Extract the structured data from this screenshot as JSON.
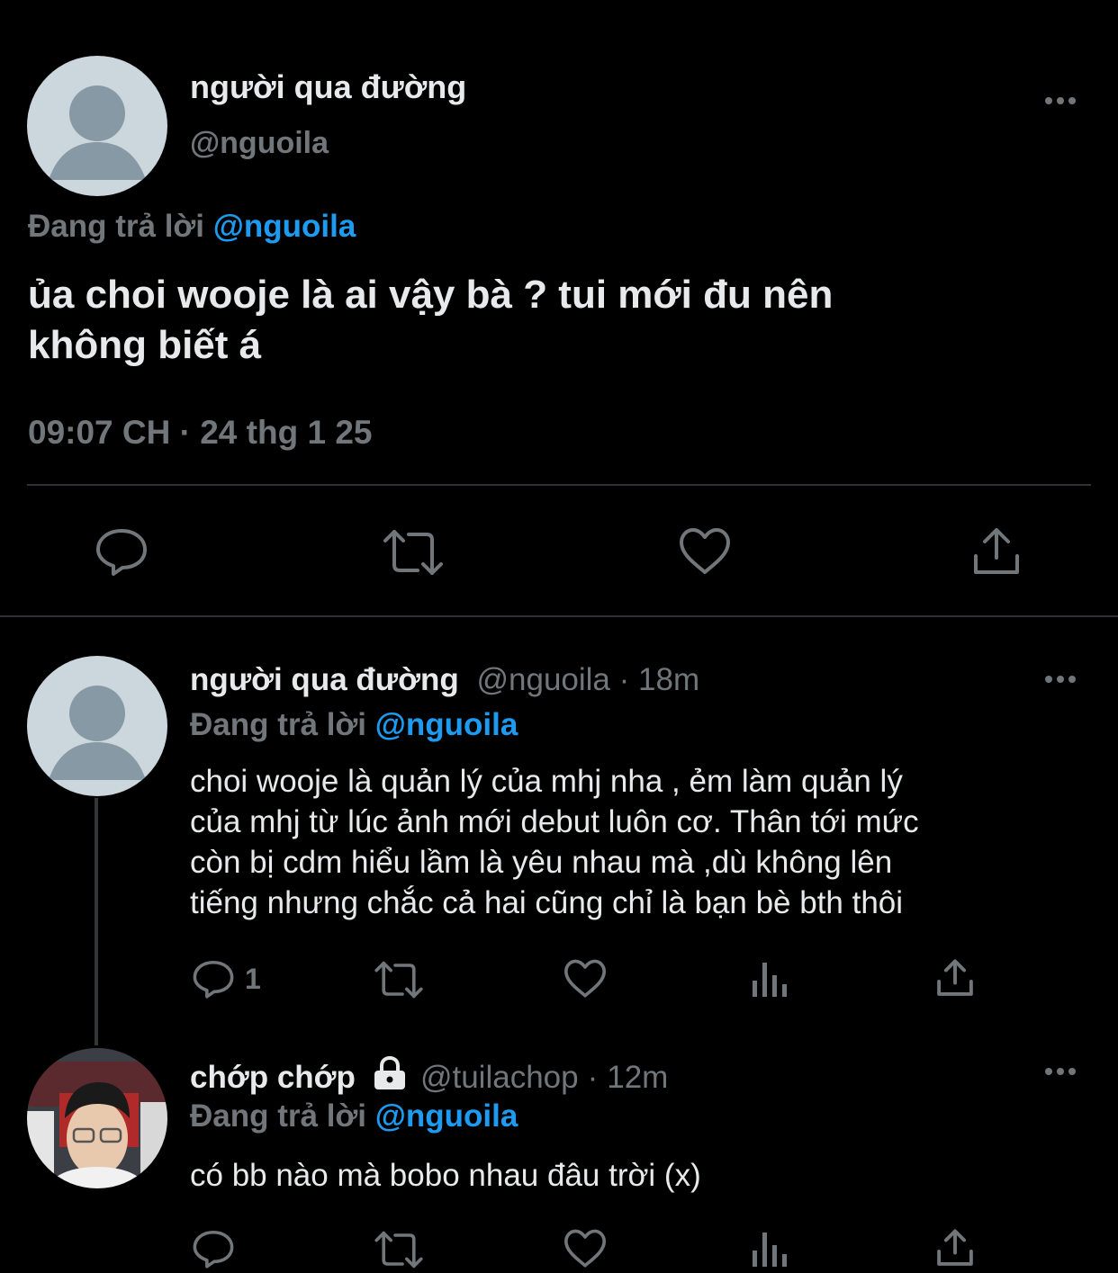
{
  "main_tweet": {
    "display_name": "người qua đường",
    "handle": "@nguoila",
    "reply_prefix": "Đang trả lời",
    "reply_to": "@nguoila",
    "text_line1": "ủa choi wooje là ai vậy bà ? tui mới đu nên",
    "text_line2": "không biết á",
    "timestamp": "09:07 CH · 24 thg 1 25"
  },
  "reply1": {
    "display_name": "người qua đường",
    "handle": "@nguoila",
    "dot": "·",
    "time": "18m",
    "reply_prefix": "Đang trả lời",
    "reply_to": "@nguoila",
    "lines": [
      "choi wooje là quản lý của mhj nha , ẻm làm quản lý",
      "của mhj từ lúc ảnh mới debut luôn cơ. Thân tới mức",
      "còn bị cdm hiểu lầm là yêu nhau mà ,dù không lên",
      "tiếng nhưng chắc cả hai cũng chỉ là bạn bè bth thôi"
    ],
    "reply_count": "1"
  },
  "reply2": {
    "display_name": "chớp chớp",
    "handle": "@tuilachop",
    "dot": "·",
    "time": "12m",
    "reply_prefix": "Đang trả lời",
    "reply_to": "@nguoila",
    "text": "có bb nào mà bobo nhau đâu trời (x)"
  },
  "colors": {
    "background": "#000000",
    "text": "#e7e9ea",
    "muted": "#71767b",
    "accent": "#1d9bf0",
    "divider": "#2f3336"
  },
  "icons": [
    "more-icon",
    "reply-icon",
    "retweet-icon",
    "like-icon",
    "share-icon",
    "analytics-icon",
    "lock-icon"
  ]
}
